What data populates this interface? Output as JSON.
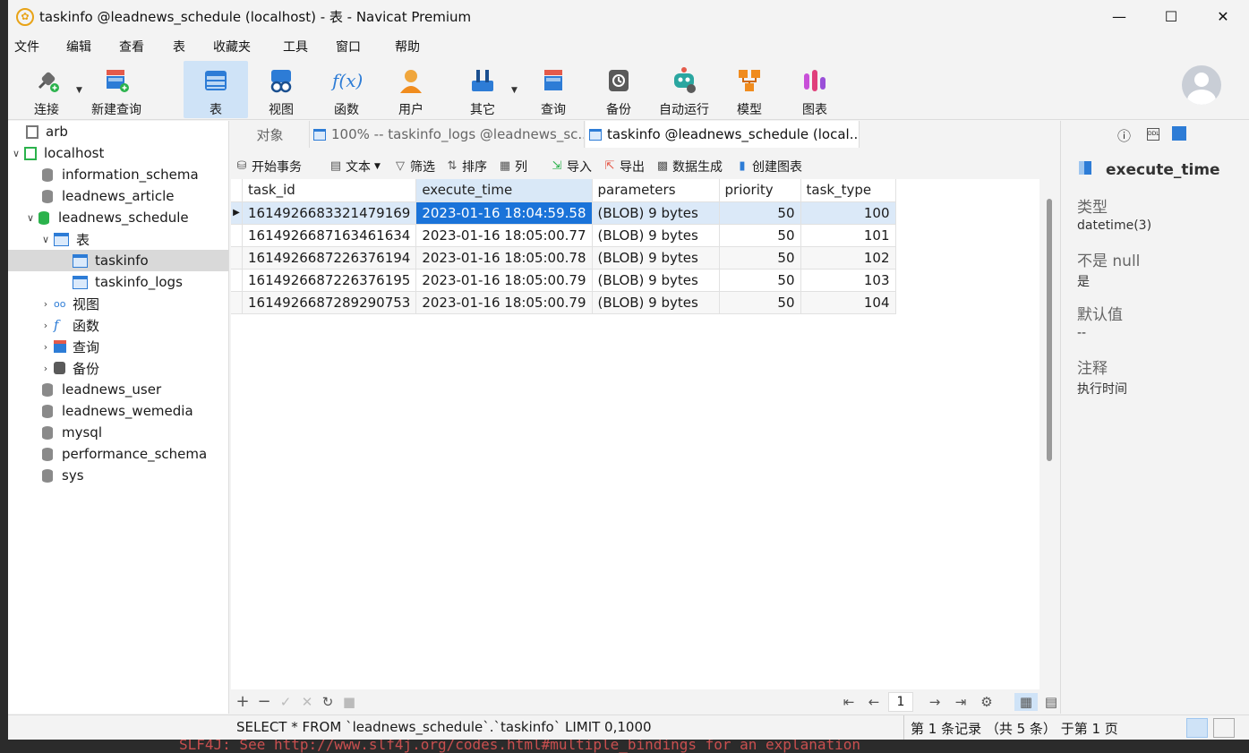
{
  "window": {
    "title": "taskinfo @leadnews_schedule (localhost) - 表 - Navicat Premium"
  },
  "menu": [
    "文件",
    "编辑",
    "查看",
    "表",
    "收藏夹",
    "工具",
    "窗口",
    "帮助"
  ],
  "toolbar": {
    "items": [
      {
        "label": "连接",
        "icon": "plug-icon"
      },
      {
        "label": "新建查询",
        "icon": "new-query-icon"
      },
      {
        "label": "表",
        "icon": "table-icon"
      },
      {
        "label": "视图",
        "icon": "view-icon"
      },
      {
        "label": "函数",
        "icon": "function-icon"
      },
      {
        "label": "用户",
        "icon": "user-icon"
      },
      {
        "label": "其它",
        "icon": "tools-icon"
      },
      {
        "label": "查询",
        "icon": "query-icon"
      },
      {
        "label": "备份",
        "icon": "backup-icon"
      },
      {
        "label": "自动运行",
        "icon": "robot-icon"
      },
      {
        "label": "模型",
        "icon": "model-icon"
      },
      {
        "label": "图表",
        "icon": "chart-icon"
      }
    ],
    "fx_glyph": "f(x)"
  },
  "sidebar": {
    "items": [
      {
        "label": "arb"
      },
      {
        "label": "localhost"
      },
      {
        "label": "information_schema"
      },
      {
        "label": "leadnews_article"
      },
      {
        "label": "leadnews_schedule"
      },
      {
        "label": "表"
      },
      {
        "label": "taskinfo"
      },
      {
        "label": "taskinfo_logs"
      },
      {
        "label": "视图"
      },
      {
        "label": "函数"
      },
      {
        "label": "查询"
      },
      {
        "label": "备份"
      },
      {
        "label": "leadnews_user"
      },
      {
        "label": "leadnews_wemedia"
      },
      {
        "label": "mysql"
      },
      {
        "label": "performance_schema"
      },
      {
        "label": "sys"
      }
    ]
  },
  "tabs": [
    {
      "label": "对象"
    },
    {
      "label": "100% -- taskinfo_logs @leadnews_sc..."
    },
    {
      "label": "taskinfo @leadnews_schedule (local..."
    }
  ],
  "content_toolbar": {
    "begin_tx": "开始事务",
    "text": "文本",
    "filter": "筛选",
    "sort": "排序",
    "columns": "列",
    "import": "导入",
    "export": "导出",
    "generate": "数据生成",
    "create_chart": "创建图表"
  },
  "table": {
    "columns": [
      "task_id",
      "execute_time",
      "parameters",
      "priority",
      "task_type"
    ],
    "rows": [
      [
        "1614926683321479169",
        "2023-01-16 18:04:59.58",
        "(BLOB) 9 bytes",
        "50",
        "100"
      ],
      [
        "1614926687163461634",
        "2023-01-16 18:05:00.77",
        "(BLOB) 9 bytes",
        "50",
        "101"
      ],
      [
        "1614926687226376194",
        "2023-01-16 18:05:00.78",
        "(BLOB) 9 bytes",
        "50",
        "102"
      ],
      [
        "1614926687226376195",
        "2023-01-16 18:05:00.79",
        "(BLOB) 9 bytes",
        "50",
        "103"
      ],
      [
        "1614926687289290753",
        "2023-01-16 18:05:00.79",
        "(BLOB) 9 bytes",
        "50",
        "104"
      ]
    ]
  },
  "pager": {
    "page": "1"
  },
  "right_panel": {
    "field_name": "execute_time",
    "type_label": "类型",
    "type_value": "datetime(3)",
    "notnull_label": "不是 null",
    "notnull_value": "是",
    "default_label": "默认值",
    "default_value": "--",
    "comment_label": "注释",
    "comment_value": "执行时间"
  },
  "status": {
    "sql": "SELECT * FROM `leadnews_schedule`.`taskinfo` LIMIT 0,1000",
    "record_info": "第 1 条记录 （共 5 条） 于第 1 页"
  },
  "background_terminal": "SLF4J: See http://www.slf4j.org/codes.html#multiple_bindings for an explanation",
  "colors": {
    "selection": "#1a73d9",
    "accent": "#2d7cd6",
    "active_tool": "#cfe3f7"
  }
}
